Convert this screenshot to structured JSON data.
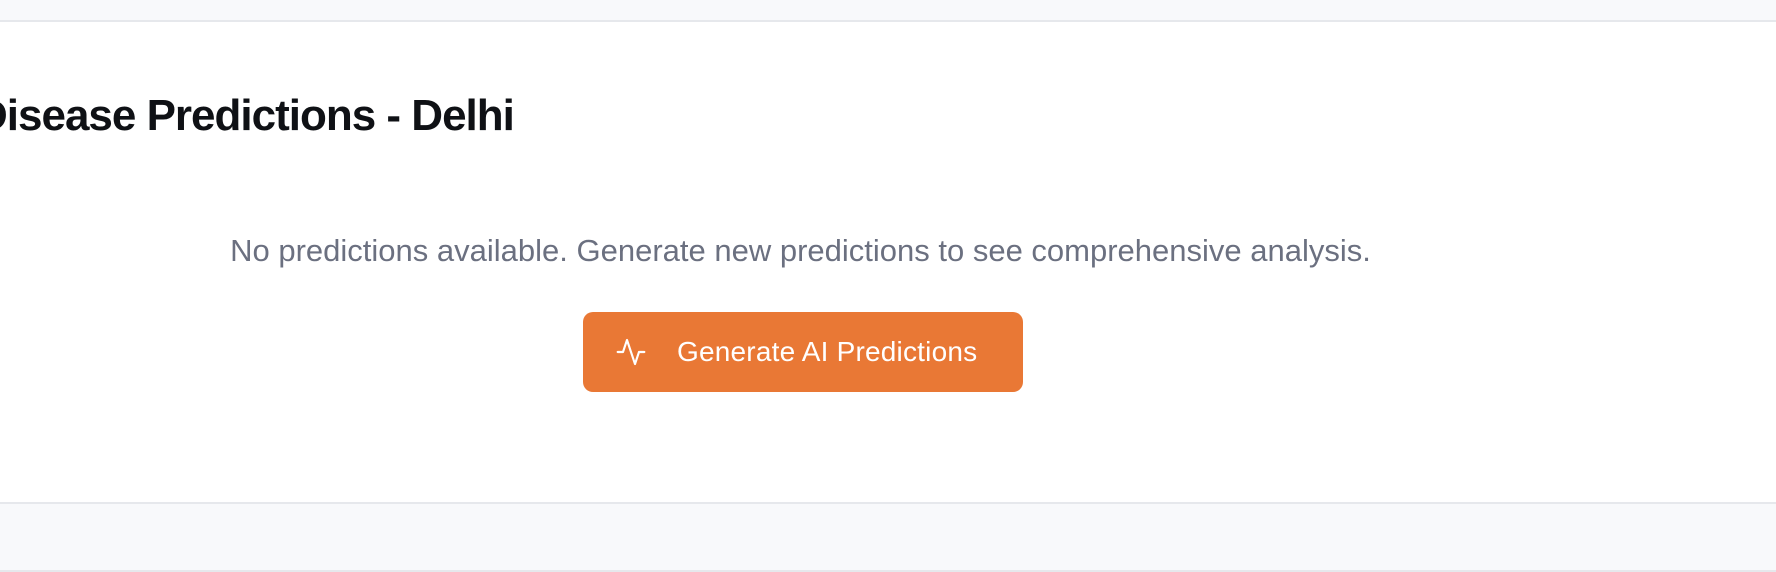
{
  "card": {
    "title": "Disease Predictions - Delhi"
  },
  "empty_state": {
    "message": "No predictions available. Generate new predictions to see comprehensive analysis.",
    "button_label": "Generate AI Predictions",
    "button_icon": "activity-icon"
  },
  "colors": {
    "accent": "#e97835",
    "page_background": "#f8f9fb",
    "card_background": "#ffffff",
    "title_text": "#0f1115",
    "muted_text": "#6b7080"
  }
}
